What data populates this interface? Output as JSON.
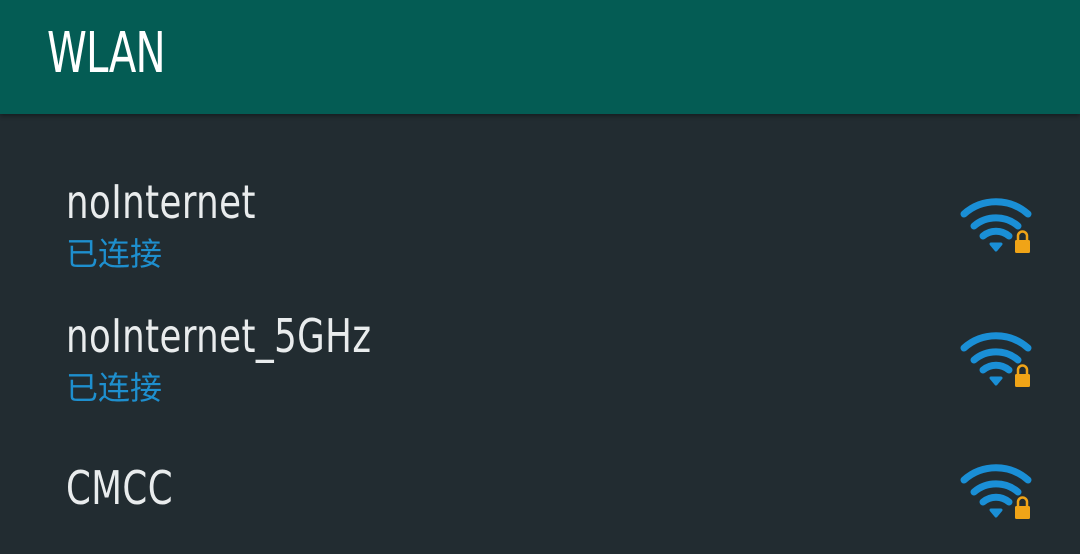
{
  "header": {
    "title": "WLAN"
  },
  "networks": [
    {
      "ssid": "noInternet",
      "status": "已连接",
      "signal_icon": "wifi-lock-icon",
      "secured": true
    },
    {
      "ssid": "noInternet_5GHz",
      "status": "已连接",
      "signal_icon": "wifi-lock-icon",
      "secured": true
    },
    {
      "ssid": "CMCC",
      "status": "",
      "signal_icon": "wifi-lock-icon",
      "secured": true
    }
  ],
  "colors": {
    "app_bar": "#045c54",
    "background": "#222c31",
    "status_text": "#1e8fce",
    "wifi_icon": "#1a8fd6",
    "lock_icon": "#f0a417"
  }
}
